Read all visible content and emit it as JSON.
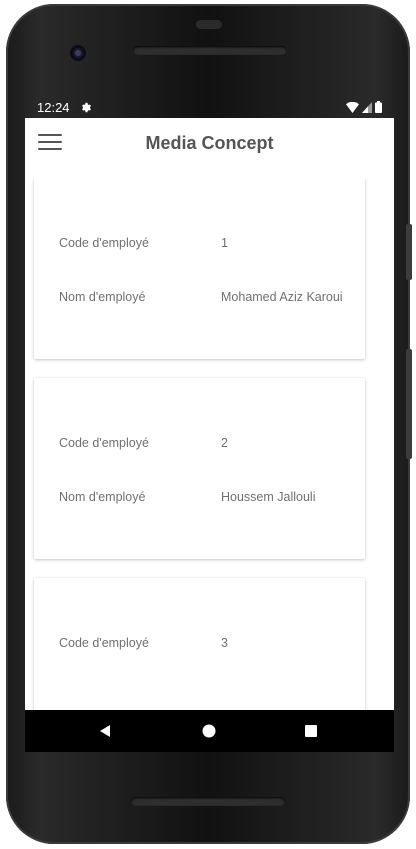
{
  "status_bar": {
    "time": "12:24"
  },
  "app_bar": {
    "title": "Media Concept",
    "menu_icon": "hamburger-menu-icon"
  },
  "employees": [
    {
      "code_label": "Code d'employé",
      "code": "1",
      "name_label": "Nom d'employé",
      "name": "Mohamed Aziz Karoui"
    },
    {
      "code_label": "Code d'employé",
      "code": "2",
      "name_label": "Nom d'employé",
      "name": "Houssem Jallouli"
    },
    {
      "code_label": "Code d'employé",
      "code": "3"
    }
  ],
  "nav_bar": {
    "back_icon": "back-triangle-icon",
    "home_icon": "home-circle-icon",
    "recents_icon": "recents-square-icon"
  },
  "colors": {
    "title_text": "#555555",
    "body_text": "#707070",
    "screen_bg": "#ffffff",
    "bezel": "#111111"
  }
}
